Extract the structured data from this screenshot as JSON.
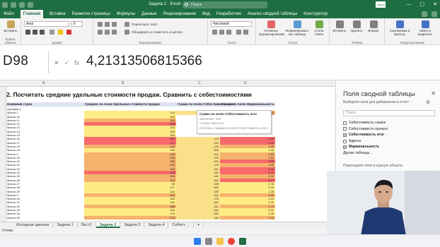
{
  "titlebar": {
    "title": "Задача 2 · Excel",
    "search_placeholder": "Поиск",
    "user_initials": "Хасан",
    "window_controls": [
      "—",
      "▢",
      "✕"
    ]
  },
  "ribbon": {
    "tabs": [
      "Файл",
      "Главная",
      "Вставка",
      "Разметка страницы",
      "Формулы",
      "Данные",
      "Рецензирование",
      "Вид",
      "Разработчик",
      "Анализ сводной таблицы",
      "Конструктор"
    ],
    "active_tab": "Главная",
    "buttons": {
      "paste": "Вставить",
      "font_name": "Arial",
      "font_size": "6",
      "wrap_text": "Переносить текст",
      "merge_center": "Объединить и поместить в центре",
      "number_format": "Числовой",
      "cond_format": "Условное форматирование",
      "format_table": "Форматировать как таблицу",
      "cell_styles": "Стили ячеек",
      "insert": "Вставить",
      "delete": "Удалить",
      "format": "Формат",
      "sort_filter": "Сортировка и фильтр",
      "find_select": "Найти и выделить"
    },
    "groups": [
      "Буфер обмена",
      "Шрифт",
      "Выравнивание",
      "Число",
      "Стили",
      "Ячейки",
      "Редактирование"
    ]
  },
  "formula_bar": {
    "name_box": "D98",
    "icons": [
      "✕",
      "✓",
      "fx"
    ],
    "value": "4,21313506815366"
  },
  "sheet": {
    "columns": [
      "A",
      "B",
      "C",
      "D"
    ],
    "task_title": "2. Посчитать средние удельные стоимости продаж. Сравнить с себестоимостями",
    "header_row": [
      "Названия строк",
      "Среднее по полю Удельные стоимости продаж",
      "Сумма по полю Себестоимость итог",
      "Сумма по полю Маржинальность"
    ],
    "rows": [
      {
        "n": "3",
        "name": "Агрофан-1",
        "c1": "",
        "c2": "",
        "c3": ""
      },
      {
        "n": "4",
        "name": "Масло-1",
        "c1": "116",
        "c2": "218",
        "c3": "1.82"
      },
      {
        "n": "5",
        "name": "Масло-10",
        "c1": "162",
        "c2": "",
        "c3": ""
      },
      {
        "n": "6",
        "name": "Масло-11",
        "c1": "328",
        "c2": "",
        "c3": ""
      },
      {
        "n": "7",
        "name": "Масло-12",
        "c1": "555",
        "c2": "",
        "c3": ""
      },
      {
        "n": "8",
        "name": "Масло-13",
        "c1": "162",
        "c2": "",
        "c3": ""
      },
      {
        "n": "9",
        "name": "Масло-14",
        "c1": "182",
        "c2": "",
        "c3": ""
      },
      {
        "n": "10",
        "name": "Масло-15",
        "c1": "200",
        "c2": "",
        "c3": ""
      },
      {
        "n": "11",
        "name": "Масло-16",
        "c1": "453",
        "c2": "120",
        "c3": "2.68"
      },
      {
        "n": "12",
        "name": "Масло-17",
        "c1": "417",
        "c2": "161",
        "c3": "2.59"
      },
      {
        "n": "13",
        "name": "Масло-18",
        "c1": "234",
        "c2": "120",
        "c3": "1.95"
      },
      {
        "n": "14",
        "name": "Масло-19",
        "c1": "186",
        "c2": "162",
        "c3": "1.15"
      },
      {
        "n": "15",
        "name": "Масло-2",
        "c1": "294",
        "c2": "161",
        "c3": "1.83"
      },
      {
        "n": "16",
        "name": "Масло-20",
        "c1": "248",
        "c2": "129",
        "c3": "1.92"
      },
      {
        "n": "17",
        "name": "Масло-21",
        "c1": "330",
        "c2": "161",
        "c3": "2.05"
      },
      {
        "n": "18",
        "name": "Масло-22",
        "c1": "240",
        "c2": "129",
        "c3": "1.86"
      },
      {
        "n": "19",
        "name": "Масло-23",
        "c1": "348",
        "c2": "161",
        "c3": "2.16"
      },
      {
        "n": "20",
        "name": "Масло-24",
        "c1": "440",
        "c2": "161",
        "c3": "2.73"
      },
      {
        "n": "21",
        "name": "Масло-25",
        "c1": "308",
        "c2": "161",
        "c3": "1.91"
      },
      {
        "n": "22",
        "name": "Масло-26",
        "c1": "350",
        "c2": "161",
        "c3": "2.17"
      },
      {
        "n": "23",
        "name": "Масло-27",
        "c1": "98",
        "c2": "129",
        "c3": "0.76"
      },
      {
        "n": "24",
        "name": "Масло-28",
        "c1": "127",
        "c2": "161",
        "c3": "0.79"
      },
      {
        "n": "25",
        "name": "Масло-29",
        "c1": "162",
        "c2": "120",
        "c3": "1.35"
      },
      {
        "n": "26",
        "name": "Масло-3",
        "c1": "314",
        "c2": "161",
        "c3": "1.95"
      },
      {
        "n": "27",
        "name": "Масло-30",
        "c1": "160",
        "c2": "129",
        "c3": "1.24"
      },
      {
        "n": "28",
        "name": "Масло-31",
        "c1": "162",
        "c2": "161",
        "c3": "1.01"
      },
      {
        "n": "29",
        "name": "Масло-32",
        "c1": "288",
        "c2": "161",
        "c3": "1.79"
      },
      {
        "n": "30",
        "name": "Масло-33",
        "c1": "146",
        "c2": "161",
        "c3": "0.91"
      },
      {
        "n": "31",
        "name": "Масло-34",
        "c1": "176",
        "c2": "161",
        "c3": "1.09"
      },
      {
        "n": "32",
        "name": "Масло-35",
        "c1": "273",
        "c2": "160",
        "c3": "1.71"
      }
    ],
    "tooltip": {
      "title": "Сумма по полю Себестоимость итог",
      "value": "Значение: 218",
      "row": "Строка: Масло-1",
      "column": "Столбец: Сумма по полю Себестоимость итог"
    }
  },
  "sheet_tabs": [
    "Исходные данные",
    "Задача 1",
    "Лист1",
    "Задача 2",
    "Задача 3",
    "Задача 4",
    "Себест ...",
    "+"
  ],
  "active_sheet": "Задача 2",
  "status": "Готово",
  "pivot_pane": {
    "title": "Поля сводной таблицы",
    "close": "✕",
    "subtitle": "Выберите поля для добавления в отчет:",
    "search_placeholder": "Поиск",
    "fields": [
      {
        "label": "Себестоимость сказок",
        "checked": false,
        "bold": false
      },
      {
        "label": "Себестоимость прочего",
        "checked": false,
        "bold": false
      },
      {
        "label": "Себестоимость итог",
        "checked": true,
        "bold": true
      },
      {
        "label": "Адреса",
        "checked": false,
        "bold": false
      },
      {
        "label": "Маржинальность",
        "checked": true,
        "bold": true
      },
      {
        "label": "Другие таблицы...",
        "checked": null,
        "bold": false
      }
    ],
    "hint": "Перетащите поля в нужную область:"
  },
  "colors": {
    "excel_green": "#1e6e42",
    "heat_high": "#f8696b",
    "heat_mid": "#ffeb84",
    "heat_low": "#f5b26c"
  }
}
